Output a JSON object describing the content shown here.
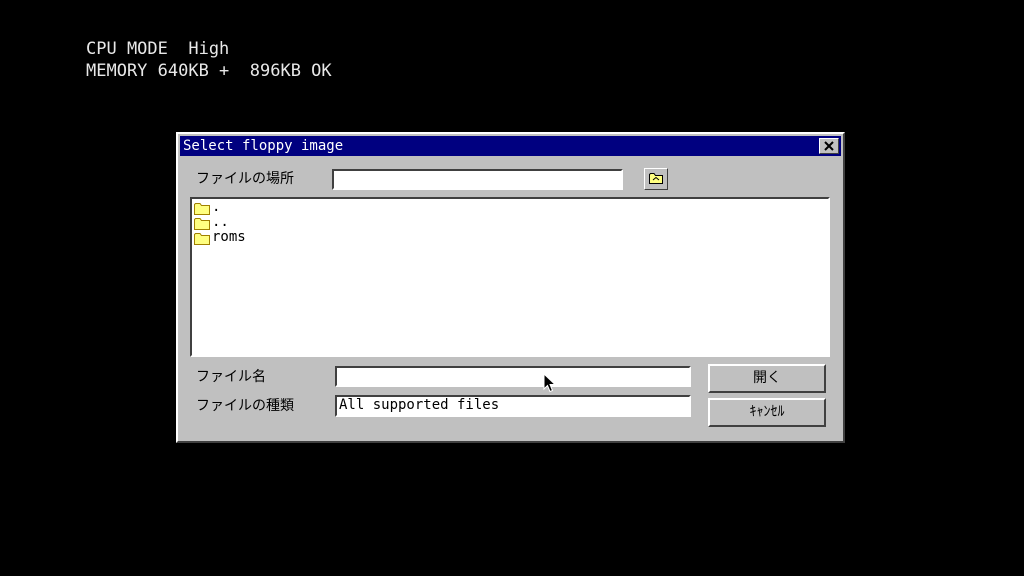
{
  "boot": {
    "line1": "CPU MODE  High",
    "line2": "MEMORY 640KB +  896KB OK"
  },
  "dialog": {
    "title": "Select floppy image",
    "location_label": "ファイルの場所",
    "location_value": "",
    "files": [
      {
        "name": ".",
        "icon": "folder-icon"
      },
      {
        "name": "..",
        "icon": "folder-icon"
      },
      {
        "name": "roms",
        "icon": "folder-icon"
      }
    ],
    "filename_label": "ファイル名",
    "filename_value": "",
    "filetype_label": "ファイルの種類",
    "filetype_value": "All supported files",
    "open_button": "開く",
    "cancel_button": "ｷｬﾝｾﾙ"
  },
  "colors": {
    "background": "#000000",
    "dialog_face": "#c0c0c0",
    "titlebar": "#000080",
    "folder": "#ffff80"
  }
}
